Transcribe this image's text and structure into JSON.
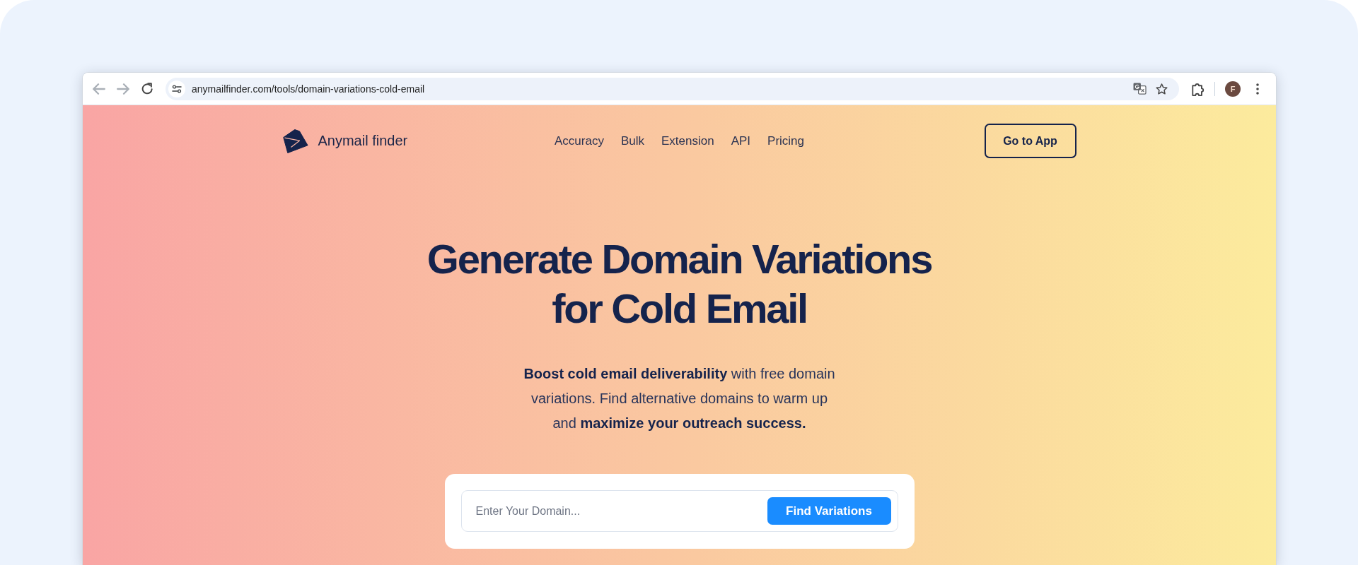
{
  "browser": {
    "back": {
      "disabled": true
    },
    "forward": {
      "disabled": true
    },
    "url": "anymailfinder.com/tools/domain-variations-cold-email",
    "profile_initial": "F"
  },
  "header": {
    "logo_text": "Anymail finder",
    "nav_links": [
      "Accuracy",
      "Bulk",
      "Extension",
      "API",
      "Pricing"
    ],
    "cta_button": "Go to App"
  },
  "hero": {
    "title": "Generate Domain Variations for Cold Email",
    "subtitle": "**Boost cold email deliverability** with free domain variations. Find alternative domains to warm up and **maximize your outreach success.**"
  },
  "search": {
    "placeholder": "Enter Your Domain...",
    "button": "Find Variations"
  }
}
